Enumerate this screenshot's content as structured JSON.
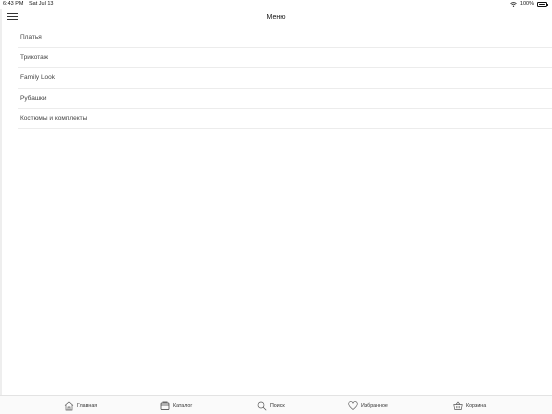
{
  "status_bar": {
    "time": "6:43 PM",
    "date": "Sat Jul 13",
    "battery_text": "100%",
    "battery_level": 1.0
  },
  "nav": {
    "title": "Меню",
    "menu_icon": "hamburger-icon"
  },
  "menu": {
    "items": [
      {
        "label": "Платья"
      },
      {
        "label": "Трикотаж"
      },
      {
        "label": "Family Look"
      },
      {
        "label": "Рубашки"
      },
      {
        "label": "Костюмы и комплекты"
      }
    ]
  },
  "tab_bar": {
    "tabs": [
      {
        "label": "Главная",
        "icon": "home-icon"
      },
      {
        "label": "Каталог",
        "icon": "catalog-icon"
      },
      {
        "label": "Поиск",
        "icon": "search-icon"
      },
      {
        "label": "Избранное",
        "icon": "heart-icon"
      },
      {
        "label": "Корзина",
        "icon": "basket-icon"
      }
    ]
  }
}
